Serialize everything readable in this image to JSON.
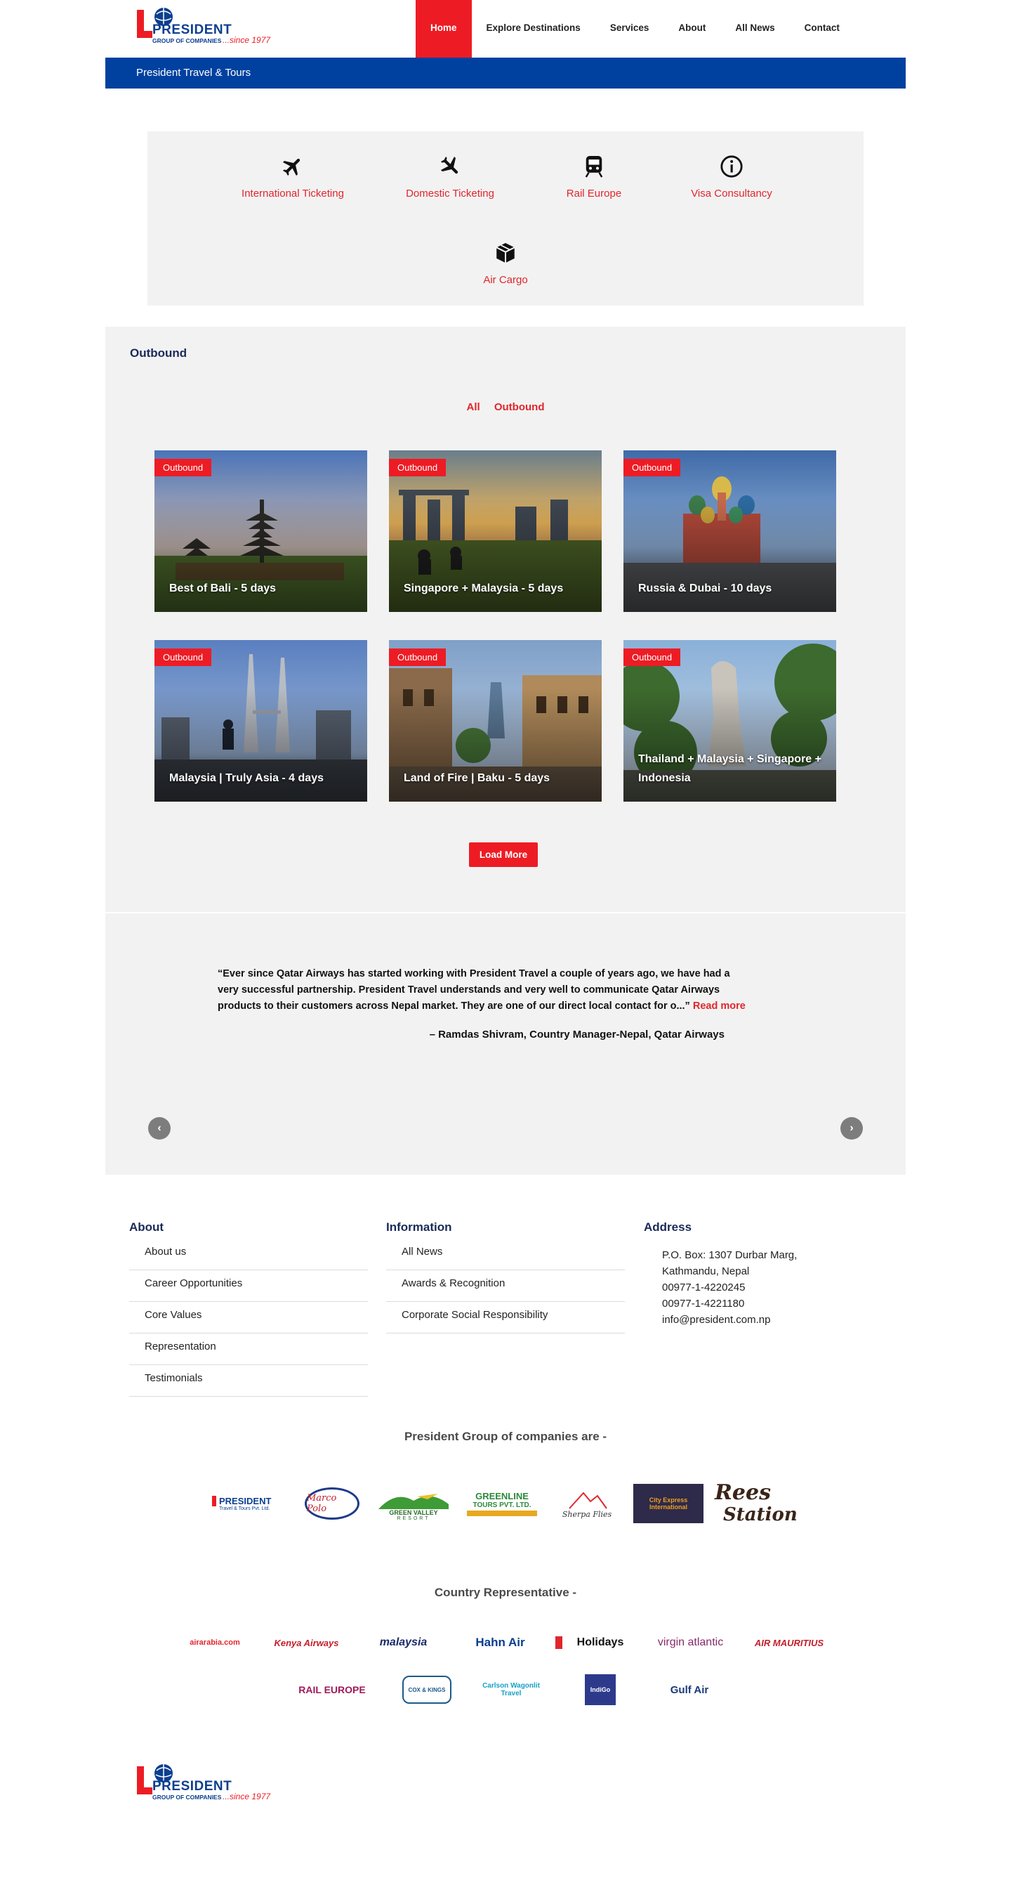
{
  "brand": {
    "name": "PRESIDENT",
    "sub": "GROUP OF COMPANIES",
    "since": "...since 1977",
    "colors": {
      "red": "#ed1c24",
      "blue": "#0041a0",
      "navy": "#1a2a5a"
    }
  },
  "nav": {
    "items": [
      "Home",
      "Explore Destinations",
      "Services",
      "About",
      "All News",
      "Contact"
    ],
    "active": "Home"
  },
  "bluebar": {
    "title": "President Travel & Tours"
  },
  "services": [
    {
      "icon": "airplane-icon",
      "label": "International Ticketing"
    },
    {
      "icon": "airplane-icon",
      "label": "Domestic Ticketing"
    },
    {
      "icon": "train-icon",
      "label": "Rail Europe"
    },
    {
      "icon": "info-icon",
      "label": "Visa Consultancy"
    },
    {
      "icon": "box-icon",
      "label": "Air Cargo"
    }
  ],
  "outbound": {
    "title": "Outbound",
    "filters": [
      "All",
      "Outbound"
    ],
    "cards": [
      {
        "badge": "Outbound",
        "title": "Best of Bali - 5 days"
      },
      {
        "badge": "Outbound",
        "title": "Singapore + Malaysia - 5 days"
      },
      {
        "badge": "Outbound",
        "title": "Russia & Dubai - 10 days"
      },
      {
        "badge": "Outbound",
        "title": "Malaysia | Truly Asia - 4 days"
      },
      {
        "badge": "Outbound",
        "title": "Land of Fire | Baku - 5 days"
      },
      {
        "badge": "Outbound",
        "title": "Thailand + Malaysia + Singapore + Indonesia"
      }
    ],
    "load_more": "Load More"
  },
  "testimonial": {
    "quote": "“Ever since Qatar Airways has started working with President Travel a couple of years ago, we have had a very successful partnership. President Travel understands and very well to communicate Qatar Airways products to their customers across Nepal market. They are one of our direct local contact for o...”",
    "read_more": "Read more",
    "author": "– Ramdas Shivram, Country Manager-Nepal, Qatar Airways",
    "prev": "‹",
    "next": "›"
  },
  "footer": {
    "about": {
      "title": "About",
      "items": [
        "About us",
        "Career Opportunities",
        "Core Values",
        "Representation",
        "Testimonials"
      ]
    },
    "information": {
      "title": "Information",
      "items": [
        "All News",
        "Awards & Recognition",
        "Corporate Social Responsibility"
      ]
    },
    "address": {
      "title": "Address",
      "lines": [
        "P.O. Box: 1307 Durbar Marg, Kathmandu, Nepal",
        "00977-1-4220245",
        "00977-1-4221180",
        "info@president.com.np"
      ]
    }
  },
  "group": {
    "title": "President Group of companies are -",
    "logos": [
      {
        "name": "PRESIDENT",
        "sub": "Travel & Tours Pvt. Ltd."
      },
      {
        "name": "Marco Polo",
        "sub": ""
      },
      {
        "name": "GREEN VALLEY",
        "sub": "RESORT"
      },
      {
        "name": "GREENLINE",
        "sub": "TOURS PVT. LTD."
      },
      {
        "name": "Sherpa Flies",
        "sub": ""
      },
      {
        "name": "City Express",
        "sub": "International"
      },
      {
        "name": "Rees",
        "sub": "Station"
      }
    ]
  },
  "representative": {
    "title": "Country Representative -",
    "row1": [
      "airarabia.com",
      "Kenya Airways",
      "malaysia",
      "Hahn Air",
      "Holidays",
      "virgin atlantic",
      "AIR MAURITIUS"
    ],
    "row2": [
      "RAIL EUROPE",
      "COX & KINGS",
      "Carlson Wagonlit Travel",
      "IndiGo",
      "Gulf Air"
    ]
  }
}
